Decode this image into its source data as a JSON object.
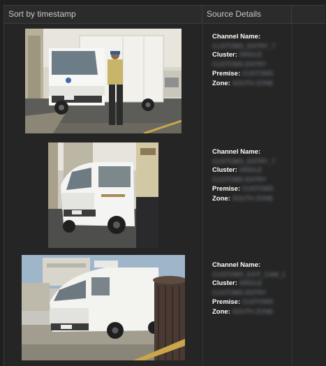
{
  "header": {
    "sort_label": "Sort by timestamp",
    "source_label": "Source Details",
    "extra_label": ""
  },
  "records": [
    {
      "channel_label": "Channel Name:",
      "channel_value": "CUSTOMS_ENTRY_7",
      "cluster_label": "Cluster:",
      "cluster_value": "SINGLE",
      "cluster_value2": "CUSTOMS ENTRY",
      "premise_label": "Premise:",
      "premise_value": "CUSTOMS",
      "zone_label": "Zone:",
      "zone_value": "SOUTH ZONE"
    },
    {
      "channel_label": "Channel Name:",
      "channel_value": "CUSTOMS_ENTRY_7",
      "cluster_label": "Cluster:",
      "cluster_value": "SINGLE",
      "cluster_value2": "CUSTOMS ENTRY",
      "premise_label": "Premise:",
      "premise_value": "CUSTOMS",
      "zone_label": "Zone:",
      "zone_value": "SOUTH ZONE"
    },
    {
      "channel_label": "Channel Name:",
      "channel_value": "CUSTOMS_EXIT_CAM_1",
      "cluster_label": "Cluster:",
      "cluster_value": "SINGLE",
      "cluster_value2": "CUSTOMS ENTRY",
      "premise_label": "Premise:",
      "premise_value": "CUSTOMS",
      "zone_label": "Zone:",
      "zone_value": "SOUTH ZONE"
    }
  ],
  "colors": {
    "background": "#1f1f1f",
    "panel": "#252525",
    "header_text": "#c8c8c8",
    "label_text": "#ffffff",
    "redacted_text": "#7c8590"
  }
}
